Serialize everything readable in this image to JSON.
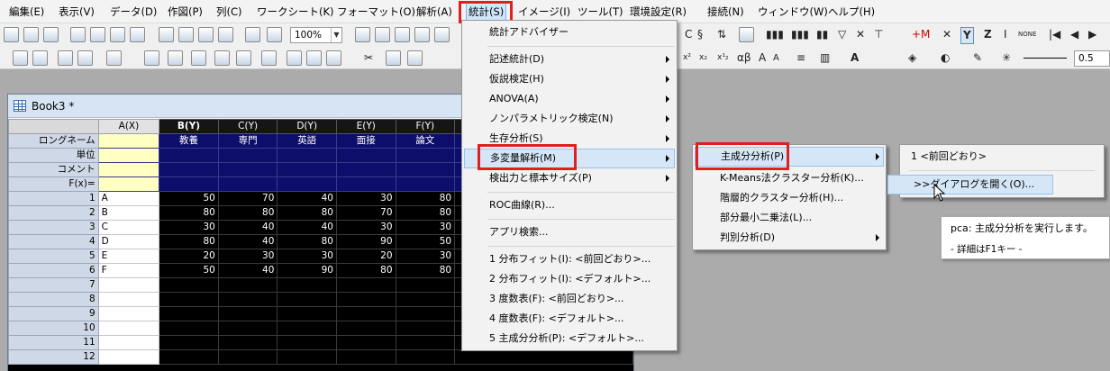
{
  "menubar": {
    "items": [
      "編集(E)",
      "表示(V)",
      "データ(D)",
      "作図(P)",
      "列(C)",
      "ワークシート(K)",
      "フォーマット(O)",
      "解析(A)",
      "統計(S)",
      "イメージ(I)",
      "ツール(T)",
      "環境設定(R)",
      "接続(N)",
      "ウィンドウ(W)",
      "ヘルプ(H)"
    ],
    "active": "統計(S)"
  },
  "toolbar": {
    "zoom": "100%",
    "line_width": "0.5"
  },
  "workbook": {
    "title": "Book3 *",
    "columns": [
      "A(X)",
      "B(Y)",
      "C(Y)",
      "D(Y)",
      "E(Y)",
      "F(Y)"
    ],
    "meta_rows": [
      "ロングネーム",
      "単位",
      "コメント",
      "F(x)="
    ],
    "long_names": [
      "",
      "教養",
      "専門",
      "英語",
      "面接",
      "論文"
    ],
    "row_numbers": [
      "1",
      "2",
      "3",
      "4",
      "5",
      "6",
      "7",
      "8",
      "9",
      "10",
      "11",
      "12"
    ],
    "rows": [
      [
        "A",
        "50",
        "70",
        "40",
        "30",
        "80"
      ],
      [
        "B",
        "80",
        "80",
        "80",
        "70",
        "80"
      ],
      [
        "C",
        "30",
        "40",
        "40",
        "30",
        "30"
      ],
      [
        "D",
        "80",
        "40",
        "80",
        "90",
        "50"
      ],
      [
        "E",
        "20",
        "30",
        "30",
        "20",
        "30"
      ],
      [
        "F",
        "50",
        "40",
        "90",
        "80",
        "80"
      ]
    ]
  },
  "stats_menu": {
    "items": [
      {
        "label": "統計アドバイザー",
        "arrow": false
      },
      {
        "label": "記述統計(D)",
        "arrow": true
      },
      {
        "label": "仮説検定(H)",
        "arrow": true
      },
      {
        "label": "ANOVA(A)",
        "arrow": true
      },
      {
        "label": "ノンパラメトリック検定(N)",
        "arrow": true
      },
      {
        "label": "生存分析(S)",
        "arrow": true
      },
      {
        "label": "多変量解析(M)",
        "arrow": true
      },
      {
        "label": "検出力と標本サイズ(P)",
        "arrow": true
      },
      {
        "label": "ROC曲線(R)...",
        "arrow": false
      },
      {
        "label": "アプリ検索...",
        "arrow": false
      },
      {
        "label": "1 分布フィット(I): <前回どおり>...",
        "arrow": false
      },
      {
        "label": "2 分布フィット(I): <デフォルト>...",
        "arrow": false
      },
      {
        "label": "3 度数表(F): <前回どおり>...",
        "arrow": false
      },
      {
        "label": "4 度数表(F): <デフォルト>...",
        "arrow": false
      },
      {
        "label": "5 主成分分析(P): <デフォルト>...",
        "arrow": false
      }
    ]
  },
  "multivariate_menu": {
    "items": [
      {
        "label": "主成分分析(P)",
        "arrow": true
      },
      {
        "label": "K-Means法クラスター分析(K)...",
        "arrow": false
      },
      {
        "label": "階層的クラスター分析(H)...",
        "arrow": false
      },
      {
        "label": "部分最小二乗法(L)...",
        "arrow": false
      },
      {
        "label": "判別分析(D)",
        "arrow": true
      }
    ]
  },
  "pca_menu": {
    "items": [
      {
        "label": "1 <前回どおり>"
      },
      {
        "label": ">>ダイアログを開く(O)..."
      }
    ]
  },
  "tooltip": {
    "line1": "pca:  主成分分析を実行します。",
    "line2": "- 詳細はF1キー -"
  }
}
